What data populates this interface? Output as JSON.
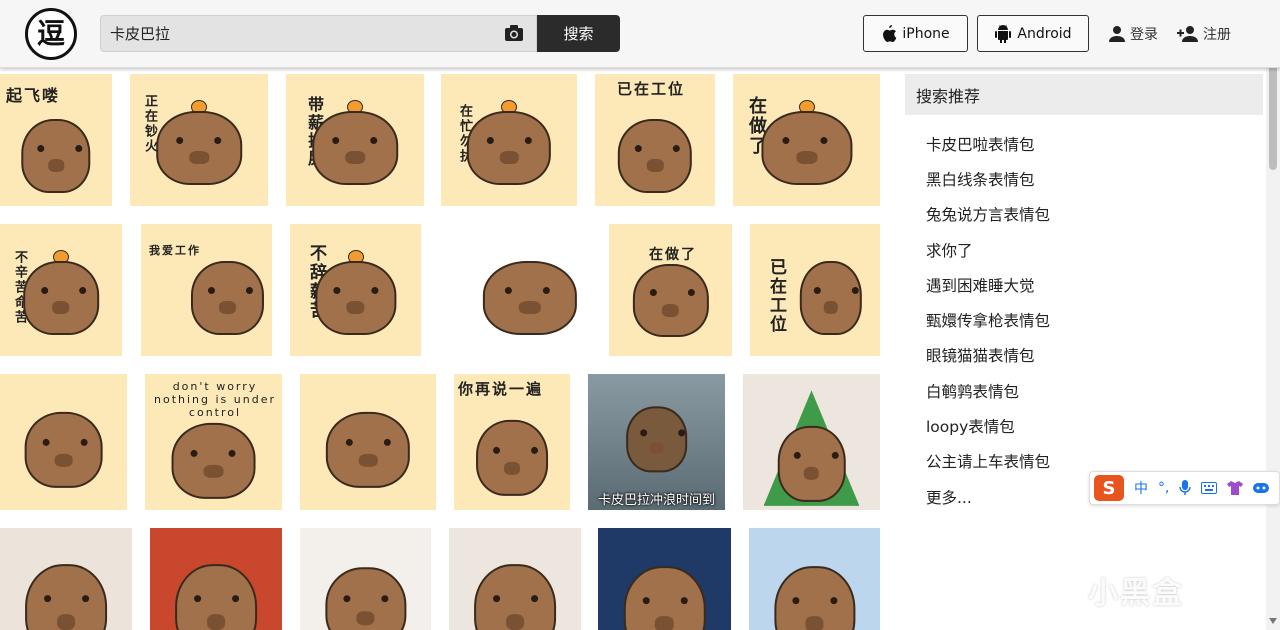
{
  "search": {
    "value": "卡皮巴拉",
    "button_label": "搜索"
  },
  "header": {
    "iphone_label": "iPhone",
    "android_label": "Android",
    "login_label": "登录",
    "register_label": "注册"
  },
  "sidebar": {
    "title": "搜索推荐",
    "items": [
      "卡皮巴啦表情包",
      "黑白线条表情包",
      "兔兔说方言表情包",
      "求你了",
      "遇到困难睡大觉",
      "甄嬛传拿枪表情包",
      "眼镜猫猫表情包",
      "白鹌鹑表情包",
      "loopy表情包",
      "公主请上车表情包",
      "更多..."
    ]
  },
  "grid": {
    "captions": {
      "t1": "起飞喽",
      "t2": "正在钞火",
      "t3": "带薪拉屎",
      "t4": "在忙勿扰",
      "t5": "已在工位",
      "t6": "在做了",
      "t7": "不辛苦命苦",
      "t8": "我爱工作",
      "t9": "不辞薪苦",
      "t11": "在做了",
      "t12": "已在工位",
      "t14": "don't worry nothing is under control",
      "t16": "你再说一遍",
      "t17": "卡皮巴拉冲浪时间到"
    }
  },
  "ime": {
    "s_label": "S",
    "lang": "中"
  },
  "watermark": "小黑盒",
  "colors": {
    "header_bg": "#f6f6f6",
    "search_btn": "#2b2b2b",
    "sidebar_head_bg": "#ececec",
    "ime_brand": "#e8541e"
  }
}
